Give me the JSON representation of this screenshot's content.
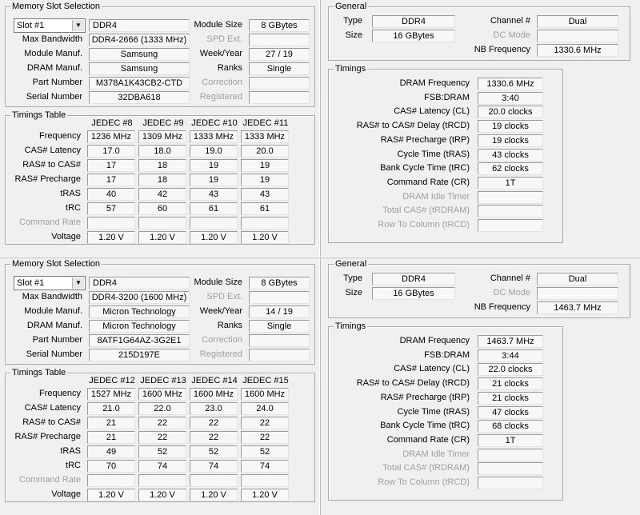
{
  "top": {
    "slot": {
      "title": "Memory Slot Selection",
      "slot_value": "Slot #1",
      "type": "DDR4",
      "labels": {
        "max_bandwidth": "Max Bandwidth",
        "module_manuf": "Module Manuf.",
        "dram_manuf": "DRAM Manuf.",
        "part_number": "Part Number",
        "serial_number": "Serial Number",
        "module_size": "Module Size",
        "spd_ext": "SPD Ext.",
        "week_year": "Week/Year",
        "ranks": "Ranks",
        "correction": "Correction",
        "registered": "Registered"
      },
      "max_bandwidth": "DDR4-2666 (1333 MHz)",
      "module_manuf": "Samsung",
      "dram_manuf": "Samsung",
      "part_number": "M378A1K43CB2-CTD",
      "serial_number": "32DBA618",
      "module_size": "8 GBytes",
      "spd_ext": "",
      "week_year": "27 / 19",
      "ranks": "Single",
      "correction": "",
      "registered": ""
    },
    "timings_table": {
      "title": "Timings Table",
      "columns": [
        "JEDEC #8",
        "JEDEC #9",
        "JEDEC #10",
        "JEDEC #11"
      ],
      "row_labels": [
        "Frequency",
        "CAS# Latency",
        "RAS# to CAS#",
        "RAS# Precharge",
        "tRAS",
        "tRC",
        "Command Rate",
        "Voltage"
      ],
      "rows": [
        [
          "1236 MHz",
          "1309 MHz",
          "1333 MHz",
          "1333 MHz"
        ],
        [
          "17.0",
          "18.0",
          "19.0",
          "20.0"
        ],
        [
          "17",
          "18",
          "19",
          "19"
        ],
        [
          "17",
          "18",
          "19",
          "19"
        ],
        [
          "40",
          "42",
          "43",
          "43"
        ],
        [
          "57",
          "60",
          "61",
          "61"
        ],
        [
          "",
          "",
          "",
          ""
        ],
        [
          "1.20 V",
          "1.20 V",
          "1.20 V",
          "1.20 V"
        ]
      ]
    },
    "general": {
      "title": "General",
      "labels": {
        "type": "Type",
        "size": "Size",
        "channel": "Channel #",
        "dc_mode": "DC Mode",
        "nb_frequency": "NB Frequency"
      },
      "type": "DDR4",
      "size": "16 GBytes",
      "channel": "Dual",
      "dc_mode": "",
      "nb_frequency": "1330.6 MHz"
    },
    "timings": {
      "title": "Timings",
      "labels": [
        "DRAM Frequency",
        "FSB:DRAM",
        "CAS# Latency (CL)",
        "RAS# to CAS# Delay (tRCD)",
        "RAS# Precharge (tRP)",
        "Cycle Time (tRAS)",
        "Bank Cycle Time (tRC)",
        "Command Rate (CR)",
        "DRAM Idle Timer",
        "Total CAS# (tRDRAM)",
        "Row To Column (tRCD)"
      ],
      "values": [
        "1330.6 MHz",
        "3:40",
        "20.0 clocks",
        "19 clocks",
        "19 clocks",
        "43 clocks",
        "62 clocks",
        "1T",
        "",
        "",
        ""
      ]
    }
  },
  "bottom": {
    "slot": {
      "title": "Memory Slot Selection",
      "slot_value": "Slot #1",
      "type": "DDR4",
      "labels": {
        "max_bandwidth": "Max Bandwidth",
        "module_manuf": "Module Manuf.",
        "dram_manuf": "DRAM Manuf.",
        "part_number": "Part Number",
        "serial_number": "Serial Number",
        "module_size": "Module Size",
        "spd_ext": "SPD Ext.",
        "week_year": "Week/Year",
        "ranks": "Ranks",
        "correction": "Correction",
        "registered": "Registered"
      },
      "max_bandwidth": "DDR4-3200 (1600 MHz)",
      "module_manuf": "Micron Technology",
      "dram_manuf": "Micron Technology",
      "part_number": "8ATF1G64AZ-3G2E1",
      "serial_number": "215D197E",
      "module_size": "8 GBytes",
      "spd_ext": "",
      "week_year": "14 / 19",
      "ranks": "Single",
      "correction": "",
      "registered": ""
    },
    "timings_table": {
      "title": "Timings Table",
      "columns": [
        "JEDEC #12",
        "JEDEC #13",
        "JEDEC #14",
        "JEDEC #15"
      ],
      "row_labels": [
        "Frequency",
        "CAS# Latency",
        "RAS# to CAS#",
        "RAS# Precharge",
        "tRAS",
        "tRC",
        "Command Rate",
        "Voltage"
      ],
      "rows": [
        [
          "1527 MHz",
          "1600 MHz",
          "1600 MHz",
          "1600 MHz"
        ],
        [
          "21.0",
          "22.0",
          "23.0",
          "24.0"
        ],
        [
          "21",
          "22",
          "22",
          "22"
        ],
        [
          "21",
          "22",
          "22",
          "22"
        ],
        [
          "49",
          "52",
          "52",
          "52"
        ],
        [
          "70",
          "74",
          "74",
          "74"
        ],
        [
          "",
          "",
          "",
          ""
        ],
        [
          "1.20 V",
          "1.20 V",
          "1.20 V",
          "1.20 V"
        ]
      ]
    },
    "general": {
      "title": "General",
      "labels": {
        "type": "Type",
        "size": "Size",
        "channel": "Channel #",
        "dc_mode": "DC Mode",
        "nb_frequency": "NB Frequency"
      },
      "type": "DDR4",
      "size": "16 GBytes",
      "channel": "Dual",
      "dc_mode": "",
      "nb_frequency": "1463.7 MHz"
    },
    "timings": {
      "title": "Timings",
      "labels": [
        "DRAM Frequency",
        "FSB:DRAM",
        "CAS# Latency (CL)",
        "RAS# to CAS# Delay (tRCD)",
        "RAS# Precharge (tRP)",
        "Cycle Time (tRAS)",
        "Bank Cycle Time (tRC)",
        "Command Rate (CR)",
        "DRAM Idle Timer",
        "Total CAS# (tRDRAM)",
        "Row To Column (tRCD)"
      ],
      "values": [
        "1463.7 MHz",
        "3:44",
        "22.0 clocks",
        "21 clocks",
        "21 clocks",
        "47 clocks",
        "68 clocks",
        "1T",
        "",
        "",
        ""
      ]
    }
  }
}
